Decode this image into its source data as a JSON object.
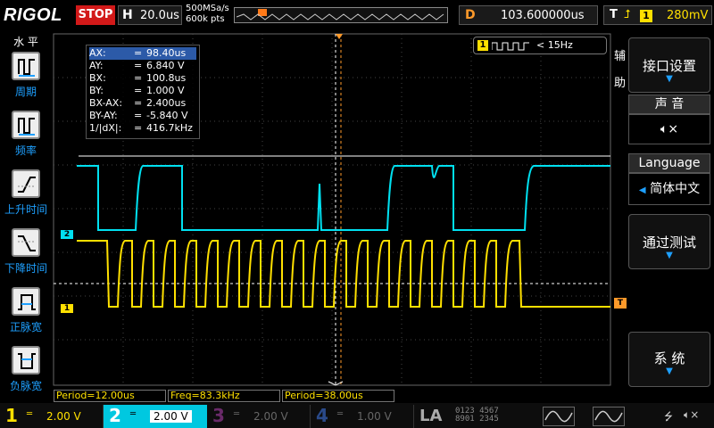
{
  "topbar": {
    "brand": "RIGOL",
    "run_state": "STOP",
    "horizontal_label": "H",
    "timebase": "20.0us",
    "sample_rate": "500MSa/s",
    "memory_depth": "600k pts",
    "delay_label": "D",
    "delay_value": "103.600000us",
    "trigger_label": "T",
    "trigger_edge_icon": "rising-edge-icon",
    "trigger_source": "1",
    "trigger_level": "280mV"
  },
  "left_menu": {
    "title": "水 平",
    "items": [
      {
        "label": "周期",
        "icon": "period-icon"
      },
      {
        "label": "频率",
        "icon": "frequency-icon"
      },
      {
        "label": "上升时间",
        "icon": "rise-time-icon"
      },
      {
        "label": "下降时间",
        "icon": "fall-time-icon"
      },
      {
        "label": "正脉宽",
        "icon": "positive-width-icon"
      },
      {
        "label": "负脉宽",
        "icon": "negative-width-icon"
      }
    ]
  },
  "cursor_readout": [
    {
      "key": "AX:",
      "value": "98.40us"
    },
    {
      "key": "AY:",
      "value": "6.840 V"
    },
    {
      "key": "BX:",
      "value": "100.8us"
    },
    {
      "key": "BY:",
      "value": "1.000 V"
    },
    {
      "key": "BX-AX:",
      "value": "2.400us"
    },
    {
      "key": "BY-AY:",
      "value": "-5.840 V"
    },
    {
      "key": "1/|dX|:",
      "value": "416.7kHz"
    }
  ],
  "freq_counter": {
    "channel": "1",
    "value": "< 15Hz"
  },
  "side_tags": {
    "top1": "辅",
    "top2": "助"
  },
  "right_menu": {
    "interface_setting": "接口设置",
    "sound_header": "声 音",
    "sound_icon": "speaker-mute-icon",
    "language_header": "Language",
    "language_value": "简体中文",
    "pass_fail": "通过测试",
    "system": "系 统"
  },
  "measurements": {
    "period": "Period=12.00us",
    "freq": "Freq=83.3kHz",
    "period2": "Period=38.00us"
  },
  "channels": [
    {
      "num": "1",
      "coupling": "═",
      "scale": "2.00 V",
      "color": "#ffe000"
    },
    {
      "num": "2",
      "coupling": "═",
      "scale": "2.00 V",
      "color": "#00e0f0"
    },
    {
      "num": "3",
      "coupling": "═",
      "scale": "2.00 V",
      "color": "#d020d0"
    },
    {
      "num": "4",
      "coupling": "═",
      "scale": "1.00 V",
      "color": "#2070ff"
    }
  ],
  "la_label": "LA",
  "digital_bits": [
    "0123 4567",
    "8901 2345"
  ],
  "markers": {
    "ch1": "1",
    "ch2": "2",
    "trigger": "T"
  },
  "colors": {
    "ch1": "#ffe000",
    "ch2": "#00e0f0",
    "accent": "#1ea0ff",
    "stop": "#d21919"
  }
}
